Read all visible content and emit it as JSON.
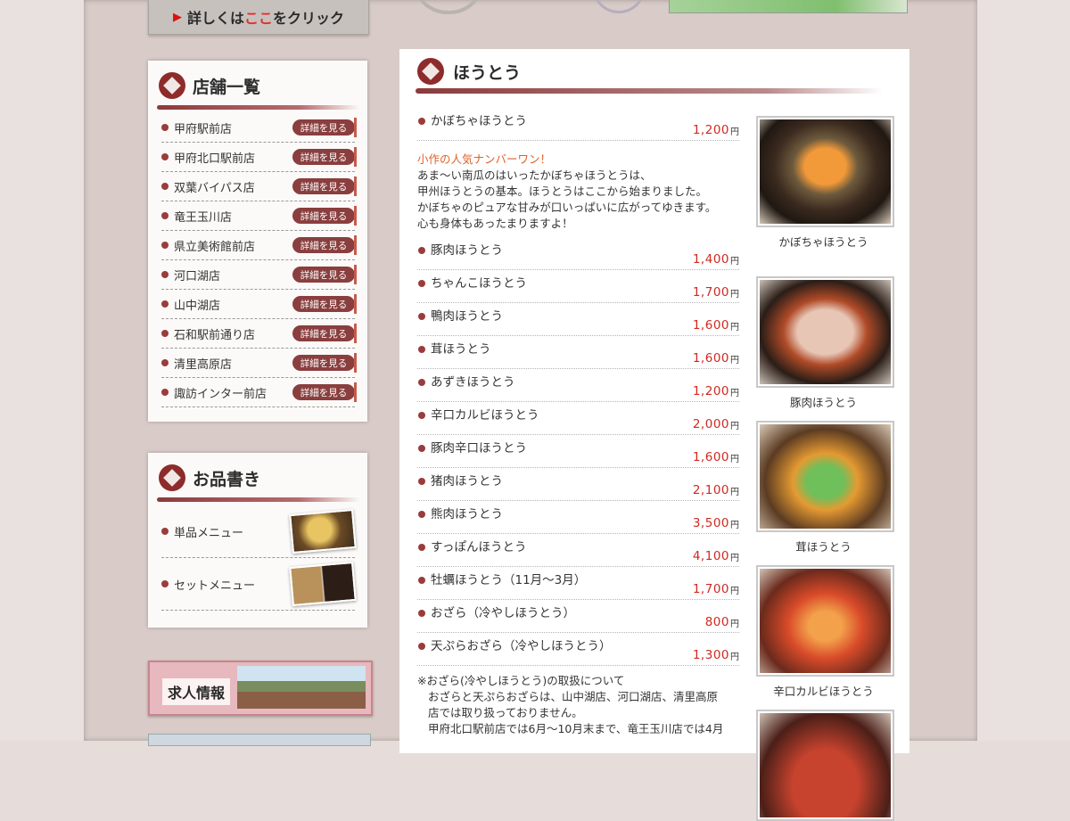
{
  "top_banner": {
    "prefix": "詳しくは",
    "highlight": "ここ",
    "suffix": "をクリック"
  },
  "stores": {
    "title": "店舗一覧",
    "detail_label": "詳細を見る",
    "items": [
      "甲府駅前店",
      "甲府北口駅前店",
      "双葉バイパス店",
      "竜王玉川店",
      "県立美術館前店",
      "河口湖店",
      "山中湖店",
      "石和駅前通り店",
      "清里高原店",
      "諏訪インター前店"
    ]
  },
  "oshinagaki": {
    "title": "お品書き",
    "items": [
      "単品メニュー",
      "セットメニュー"
    ]
  },
  "job_banner": {
    "label": "求人情報"
  },
  "main": {
    "title": "ほうとう",
    "yen": "円",
    "first_item": {
      "name": "かぼちゃほうとう",
      "price": "1,200"
    },
    "description": {
      "catch": "小作の人気ナンバーワン！",
      "lines": [
        "あま〜い南瓜のはいったかぼちゃほうとうは、",
        "甲州ほうとうの基本。ほうとうはここから始まりました。",
        "かぼちゃのピュアな甘みが口いっぱいに広がってゆきます。",
        "心も身体もあったまりますよ！"
      ]
    },
    "items": [
      {
        "name": "豚肉ほうとう",
        "price": "1,400"
      },
      {
        "name": "ちゃんこほうとう",
        "price": "1,700"
      },
      {
        "name": "鴨肉ほうとう",
        "price": "1,600"
      },
      {
        "name": "茸ほうとう",
        "price": "1,600"
      },
      {
        "name": "あずきほうとう",
        "price": "1,200"
      },
      {
        "name": "辛口カルビほうとう",
        "price": "2,000"
      },
      {
        "name": "豚肉辛口ほうとう",
        "price": "1,600"
      },
      {
        "name": "猪肉ほうとう",
        "price": "2,100"
      },
      {
        "name": "熊肉ほうとう",
        "price": "3,500"
      },
      {
        "name": "すっぽんほうとう",
        "price": "4,100"
      },
      {
        "name": "牡蠣ほうとう（11月〜3月）",
        "price": "1,700"
      },
      {
        "name": "おざら（冷やしほうとう）",
        "price": "800"
      },
      {
        "name": "天ぷらおざら（冷やしほうとう）",
        "price": "1,300"
      }
    ],
    "note": {
      "heading": "※おざら(冷やしほうとう)の取扱について",
      "lines": [
        "おざらと天ぷらおざらは、山中湖店、河口湖店、清里高原",
        "店では取り扱っておりません。",
        "甲府北口駅前店では6月〜10月末まで、竜王玉川店では4月"
      ]
    },
    "photo_captions": [
      "かぼちゃほうとう",
      "豚肉ほうとう",
      "茸ほうとう",
      "辛口カルビほうとう"
    ]
  }
}
